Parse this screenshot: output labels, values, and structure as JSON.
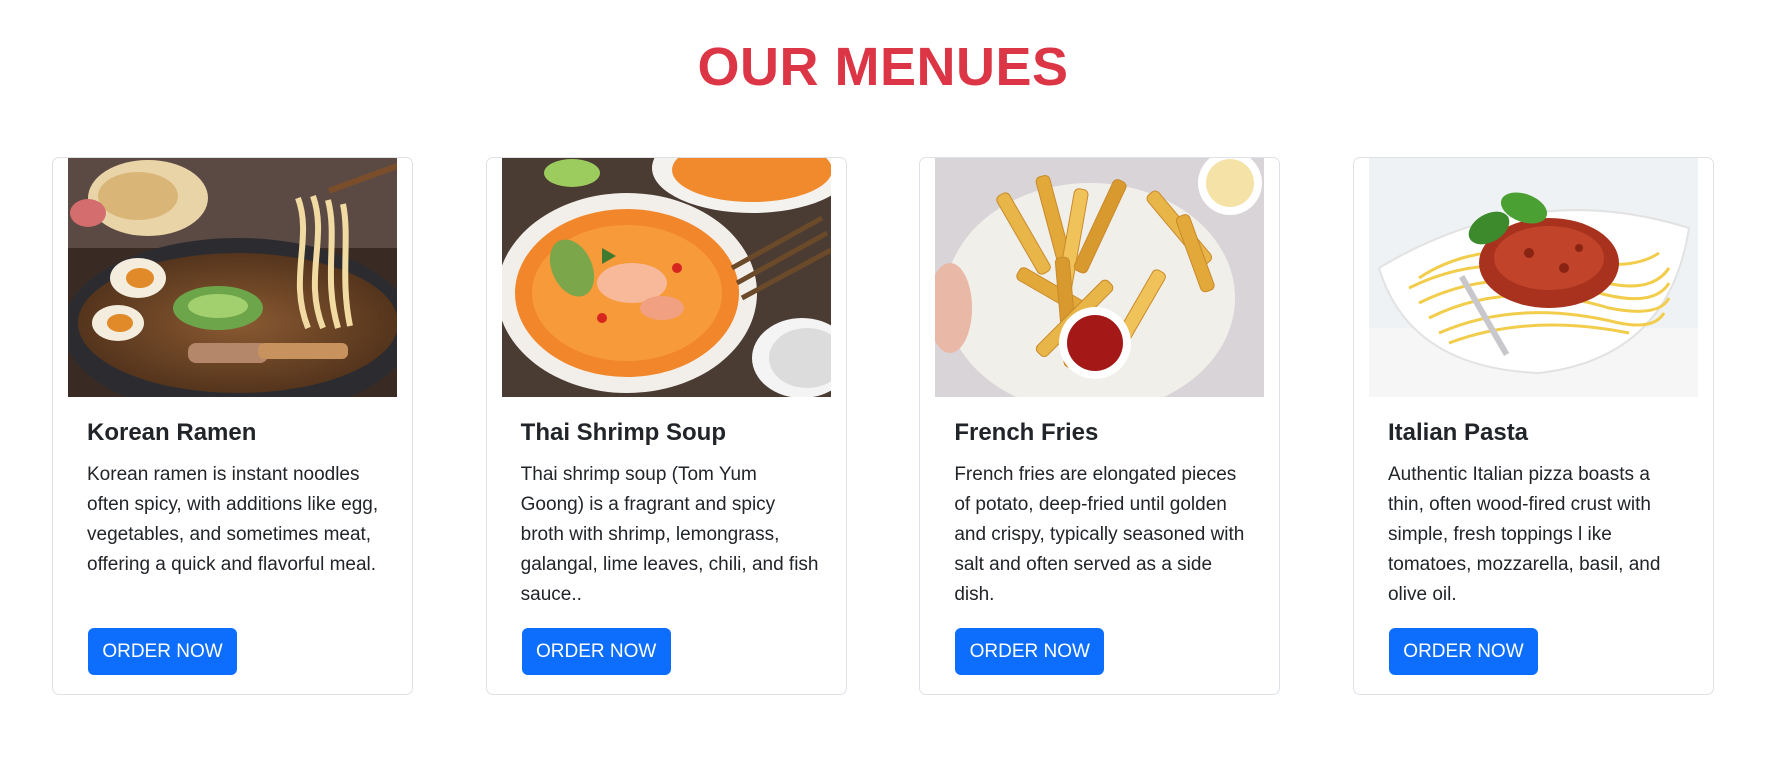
{
  "section": {
    "title": "OUR MENUES",
    "title_color": "#dc3545"
  },
  "button_color": "#0d6efd",
  "cards": [
    {
      "title": "Korean Ramen",
      "description": "Korean ramen is instant noodles often spicy, with additions like egg, vegetables, and sometimes meat, offering a quick and flavorful meal.",
      "button_label": "ORDER NOW",
      "image": "korean-ramen-photo"
    },
    {
      "title": "Thai Shrimp Soup",
      "description": "Thai shrimp soup (Tom Yum Goong) is a fragrant and spicy broth with shrimp, lemongrass, galangal, lime leaves, chili, and fish sauce..",
      "button_label": "ORDER NOW",
      "image": "thai-shrimp-soup-photo"
    },
    {
      "title": "French Fries",
      "description": "French fries are elongated pieces of potato, deep-fried until golden and crispy, typically seasoned with salt and often served as a side dish.",
      "button_label": "ORDER NOW",
      "image": "french-fries-photo"
    },
    {
      "title": "Italian Pasta",
      "description": "Authentic Italian pizza boasts a thin, often wood-fired crust with simple, fresh toppings l ike tomatoes, mozzarella, basil, and olive oil.",
      "button_label": "ORDER NOW",
      "image": "italian-pasta-photo"
    }
  ]
}
